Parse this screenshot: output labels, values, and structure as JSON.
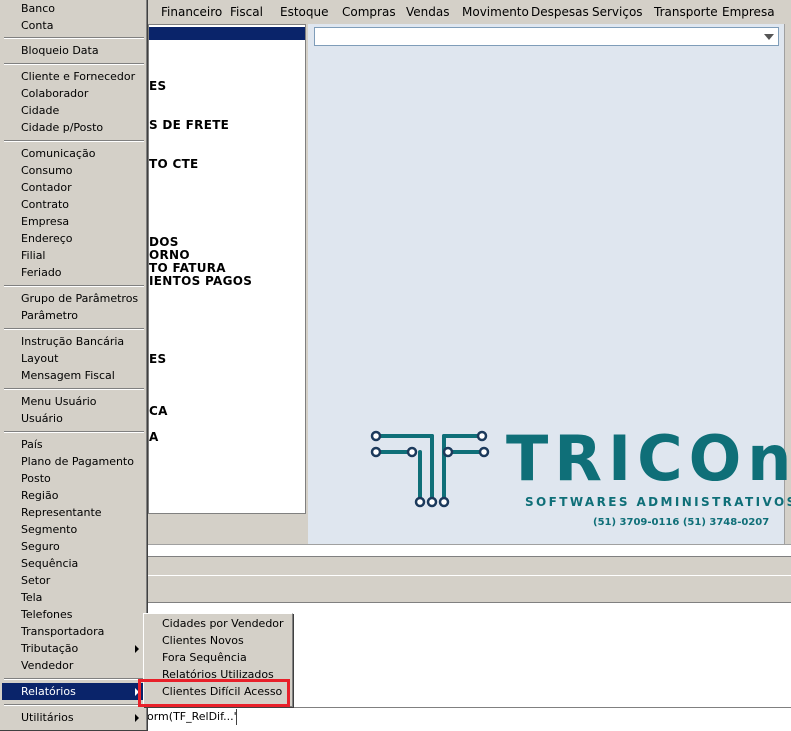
{
  "menubar": {
    "items": [
      "Financeiro",
      "Fiscal",
      "Estoque",
      "Compras",
      "Vendas",
      "Movimento",
      "Despesas",
      "Serviços",
      "Transporte",
      "Empresa"
    ]
  },
  "list_panel": {
    "lines": [
      "ES",
      "S DE FRETE",
      "TO CTE",
      "DOS",
      "ORNO",
      "TO FATURA",
      "IENTOS PAGOS",
      "ES",
      "CA",
      "A"
    ]
  },
  "logo": {
    "word": "TRICOn",
    "subtitle": "SOFTWARES ADMINISTRATIVOS",
    "phones": "(51) 3709-0116   (51) 3748-0207",
    "color": "#0f6f78"
  },
  "status_bar": {
    "text": "orm(TF_RelDif...'"
  },
  "popup_menu": {
    "items": {
      "banco": "Banco",
      "conta": "Conta",
      "bloqueio_data": "Bloqueio Data",
      "cliente_fornecedor": "Cliente e Fornecedor",
      "colaborador": "Colaborador",
      "cidade": "Cidade",
      "cidade_posto": "Cidade p/Posto",
      "comunicacao": "Comunicação",
      "consumo": "Consumo",
      "contador": "Contador",
      "contrato": "Contrato",
      "empresa": "Empresa",
      "endereco": "Endereço",
      "filial": "Filial",
      "feriado": "Feriado",
      "grupo_parametros": "Grupo de Parâmetros",
      "parametro": "Parâmetro",
      "instrucao_bancaria": "Instrução Bancária",
      "layout": "Layout",
      "mensagem_fiscal": "Mensagem Fiscal",
      "menu_usuario": "Menu Usuário",
      "usuario": "Usuário",
      "pais": "País",
      "plano_pagamento": "Plano de Pagamento",
      "posto": "Posto",
      "regiao": "Região",
      "representante": "Representante",
      "segmento": "Segmento",
      "seguro": "Seguro",
      "sequencia": "Sequência",
      "setor": "Setor",
      "tela": "Tela",
      "telefones": "Telefones",
      "transportadora": "Transportadora",
      "tributacao": "Tributação",
      "vendedor": "Vendedor",
      "relatorios": "Relatórios",
      "utilitarios": "Utilitários"
    },
    "selected": "Relatórios",
    "selection_color": "#0a246a"
  },
  "submenu": {
    "items": {
      "cidades_vendedor": "Cidades por Vendedor",
      "clientes_novos": "Clientes Novos",
      "fora_sequencia": "Fora Sequência",
      "relatorios_utilizados": "Relatórios Utilizados",
      "clientes_dificil_acesso": "Clientes Difícil Acesso"
    },
    "highlight_color": "#e8202a"
  }
}
